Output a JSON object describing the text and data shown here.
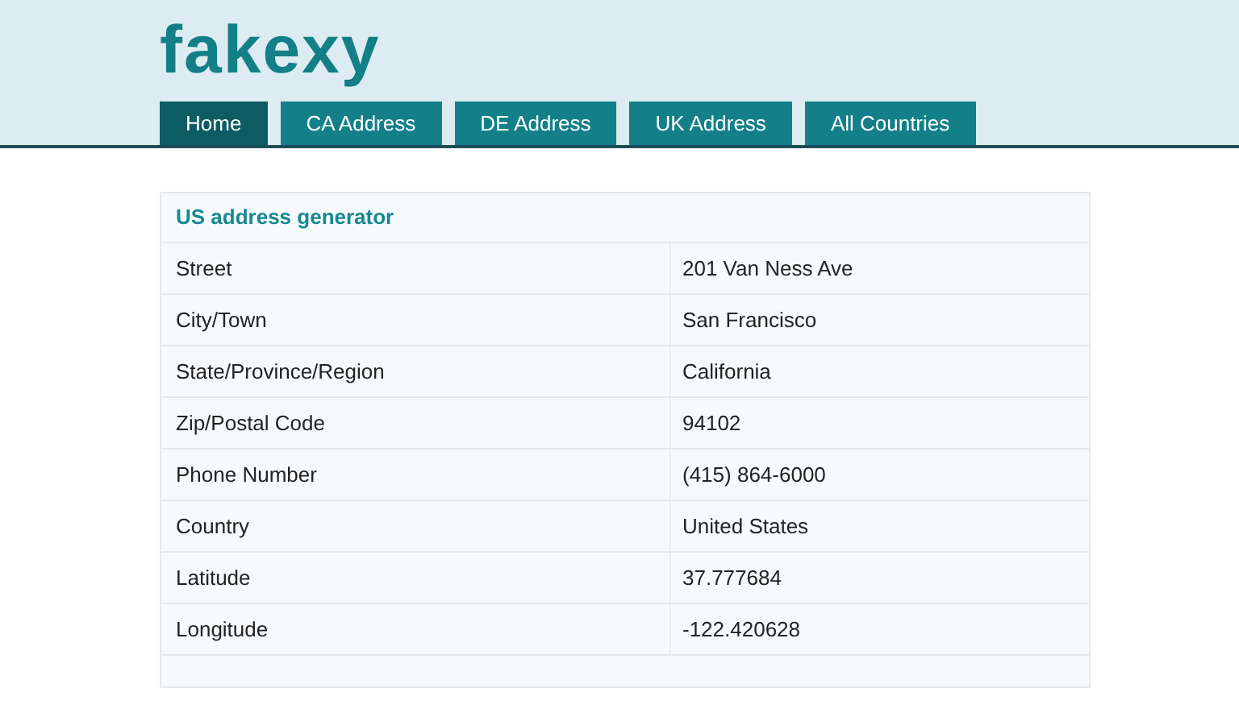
{
  "logo": "fakexy",
  "tabs": [
    {
      "label": "Home",
      "selected": true
    },
    {
      "label": "CA Address",
      "selected": false
    },
    {
      "label": "DE Address",
      "selected": false
    },
    {
      "label": "UK Address",
      "selected": false
    },
    {
      "label": "All Countries",
      "selected": false
    }
  ],
  "card": {
    "title": "US address generator",
    "rows": [
      {
        "label": "Street",
        "value": "201 Van Ness Ave"
      },
      {
        "label": "City/Town",
        "value": "San Francisco"
      },
      {
        "label": "State/Province/Region",
        "value": "California"
      },
      {
        "label": "Zip/Postal Code",
        "value": "94102"
      },
      {
        "label": "Phone Number",
        "value": "(415) 864-6000"
      },
      {
        "label": "Country",
        "value": "United States"
      },
      {
        "label": "Latitude",
        "value": "37.777684"
      },
      {
        "label": "Longitude",
        "value": "-122.420628"
      }
    ]
  }
}
